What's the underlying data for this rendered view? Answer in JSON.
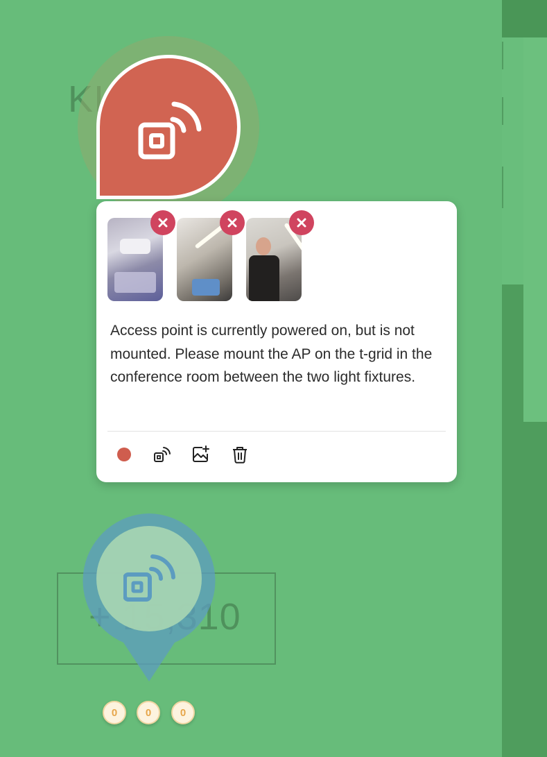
{
  "map": {
    "label_top": "KI        250",
    "label_bottom": "+ 15,310"
  },
  "popup": {
    "photos": [
      {
        "alt": "access-point-photo"
      },
      {
        "alt": "ceiling-photo"
      },
      {
        "alt": "person-photo"
      }
    ],
    "note": "Access point is currently powered on, but is not mounted. Please mount the AP on the t-grid in the conference room between the two light fixtures.",
    "status_color": "#cf5d4e",
    "actions": [
      "status-dot",
      "access-point-icon",
      "add-image-icon",
      "trash-icon"
    ]
  },
  "marker_colors": {
    "red": "#d16452",
    "blue": "#5c9cc0",
    "remove": "#d0445f"
  },
  "counters": [
    "0",
    "0",
    "0"
  ]
}
